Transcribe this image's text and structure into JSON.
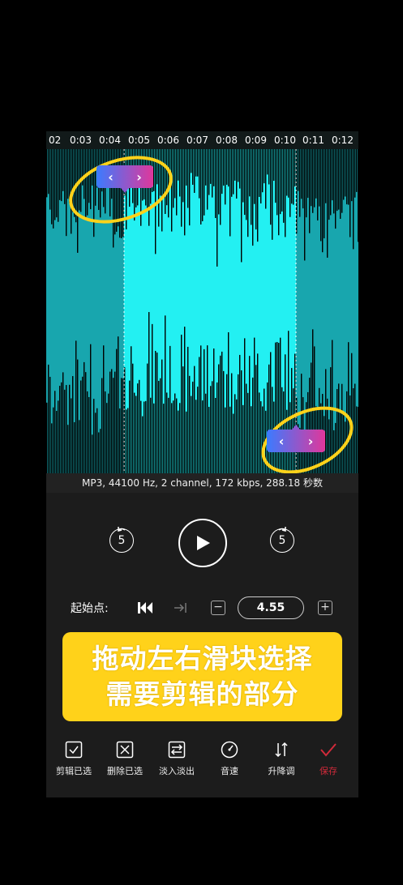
{
  "timeline": {
    "ticks": [
      "02",
      "0:03",
      "0:04",
      "0:05",
      "0:06",
      "0:07",
      "0:08",
      "0:09",
      "0:10",
      "0:11",
      "0:12"
    ]
  },
  "waveform": {
    "colors": {
      "unselected": "#18a6ae",
      "selected": "#23f0f2",
      "peaks": "#000000"
    }
  },
  "handles": {
    "left_arrow": "‹",
    "right_arrow": "›",
    "start_gradient": [
      "#3b7bff",
      "#e0379b"
    ],
    "end_gradient": [
      "#3b7bff",
      "#e0379b"
    ]
  },
  "annotation_color": "#ffd21a",
  "file_info": "MP3, 44100 Hz, 2 channel, 172 kbps, 288.18 秒数",
  "playback": {
    "rewind_seconds": "5",
    "forward_seconds": "5"
  },
  "start_point": {
    "label": "起始点:",
    "minus": "−",
    "plus": "+",
    "value": "4.55"
  },
  "banner": {
    "line1": "拖动左右滑块选择",
    "line2": "需要剪辑的部分",
    "color": "#ffd21a"
  },
  "toolbar": {
    "items": [
      {
        "label": "剪辑已选"
      },
      {
        "label": "删除已选"
      },
      {
        "label": "淡入淡出"
      },
      {
        "label": "音速"
      },
      {
        "label": "升降调"
      },
      {
        "label": "保存",
        "color": "#d12a3a"
      }
    ]
  }
}
